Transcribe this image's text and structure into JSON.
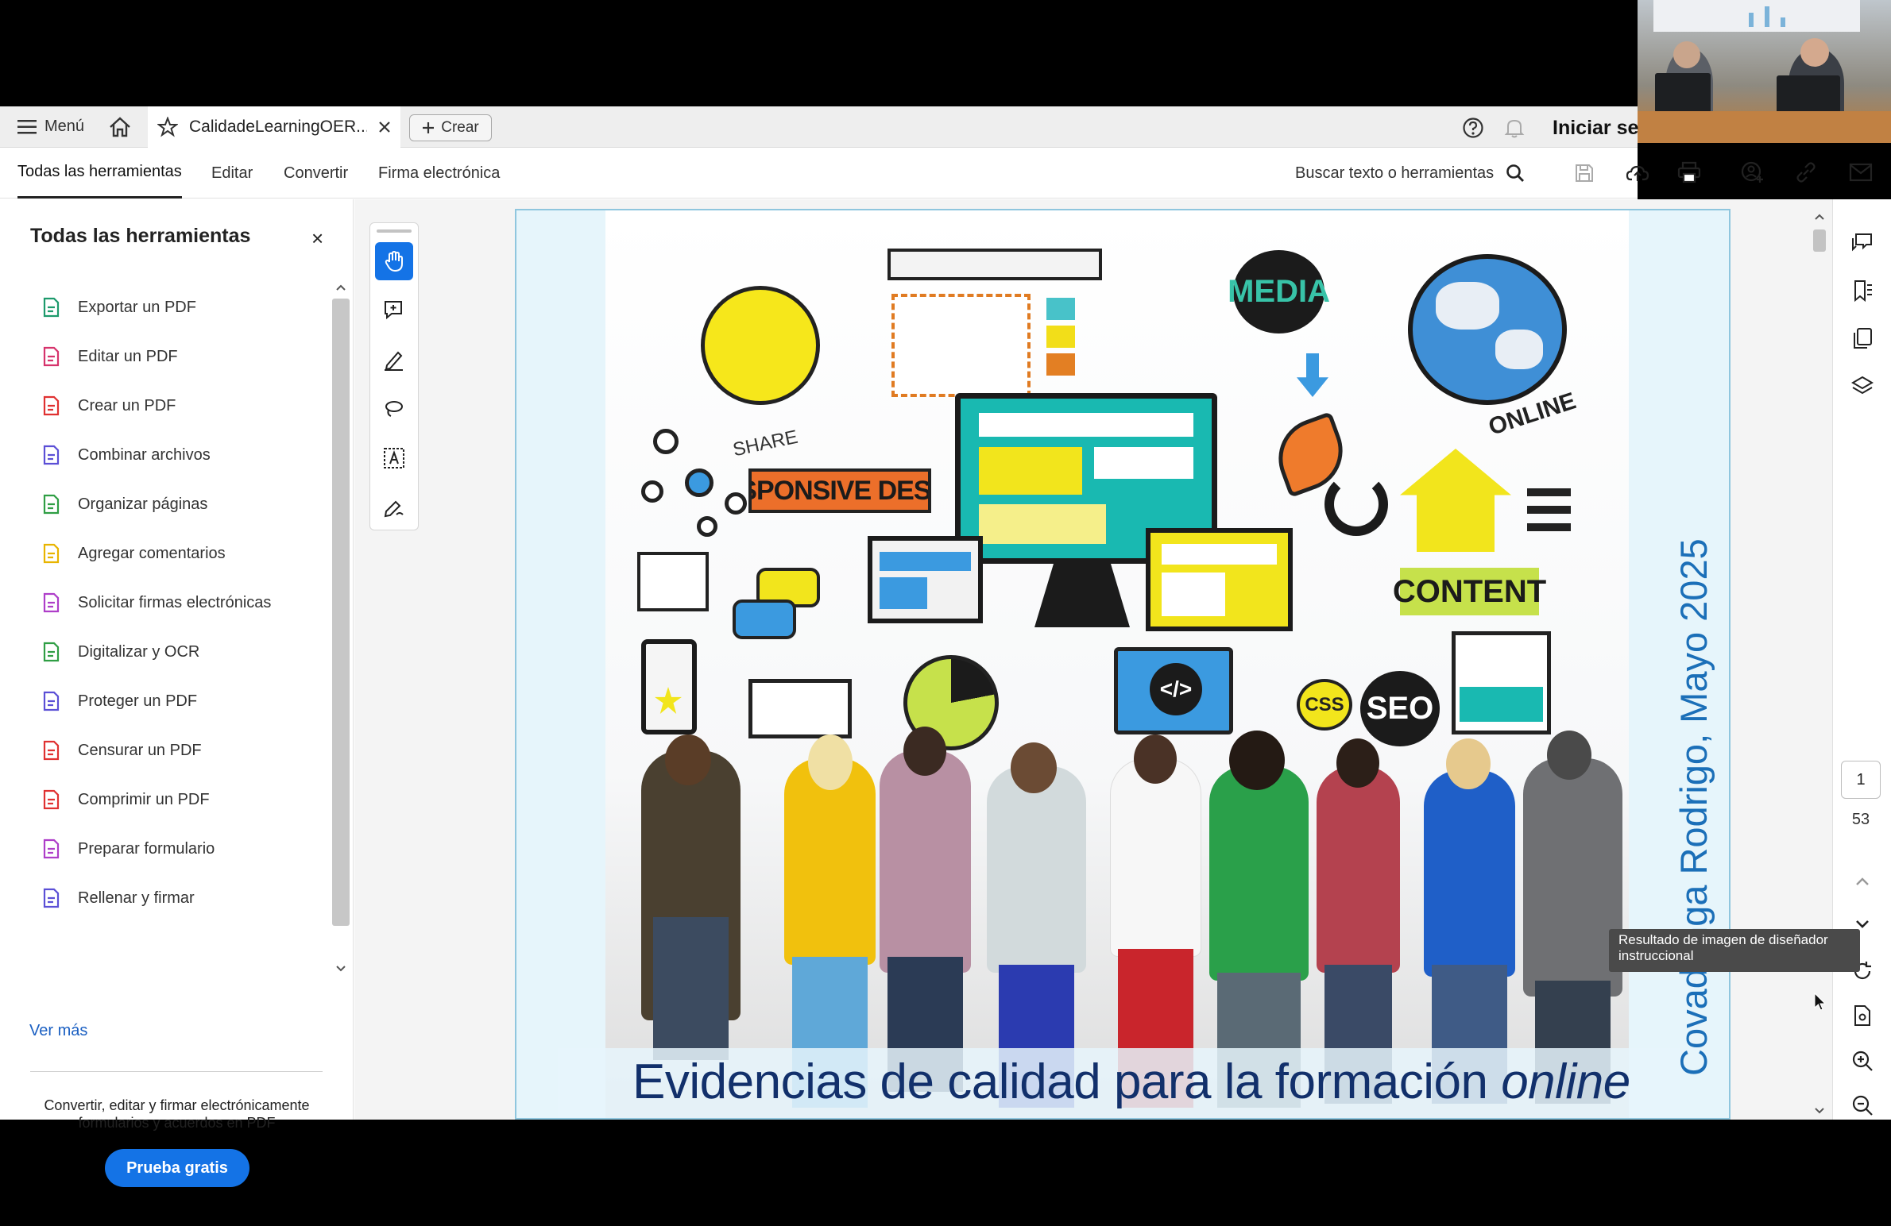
{
  "tabbar": {
    "menu_label": "Menú",
    "tab_title": "CalidadeLearningOER...",
    "create_label": "Crear",
    "signin_label": "Iniciar se"
  },
  "toolbar": {
    "tabs": [
      "Todas las herramientas",
      "Editar",
      "Convertir",
      "Firma electrónica"
    ],
    "search_label": "Buscar texto o herramientas"
  },
  "sidepanel": {
    "title": "Todas las herramientas",
    "items": [
      {
        "label": "Exportar un PDF",
        "color": "#1d9a6c"
      },
      {
        "label": "Editar un PDF",
        "color": "#d6336c"
      },
      {
        "label": "Crear un PDF",
        "color": "#e03131"
      },
      {
        "label": "Combinar archivos",
        "color": "#5b4fd6"
      },
      {
        "label": "Organizar páginas",
        "color": "#2f9e44"
      },
      {
        "label": "Agregar comentarios",
        "color": "#e8b400"
      },
      {
        "label": "Solicitar firmas electrónicas",
        "color": "#ae3ec9"
      },
      {
        "label": "Digitalizar y OCR",
        "color": "#2f9e44"
      },
      {
        "label": "Proteger un PDF",
        "color": "#5b4fd6"
      },
      {
        "label": "Censurar un PDF",
        "color": "#e03131"
      },
      {
        "label": "Comprimir un PDF",
        "color": "#e03131"
      },
      {
        "label": "Preparar formulario",
        "color": "#ae3ec9"
      },
      {
        "label": "Rellenar y firmar",
        "color": "#5b4fd6"
      }
    ],
    "more_label": "Ver más",
    "promo_text": "Convertir, editar y firmar electrónicamente formularios y acuerdos en PDF",
    "cta_label": "Prueba gratis"
  },
  "document": {
    "caption_main": "Evidencias de calidad para la formación",
    "caption_italic": "online",
    "vertical_text": "Covadonga Rodrigo, Mayo 2025",
    "art_words": [
      "MEDIA",
      "ONLINE",
      "SHARE",
      "RESPONSIVE DESIGN",
      "CONTENT",
      "SEO",
      "CSS"
    ]
  },
  "pagination": {
    "current": "1",
    "total": "53"
  },
  "tooltip": "Resultado de imagen de diseñador instruccional",
  "colors": {
    "accent": "#1473e6",
    "caption": "#12306b",
    "vertical_text": "#1b6fb8"
  }
}
